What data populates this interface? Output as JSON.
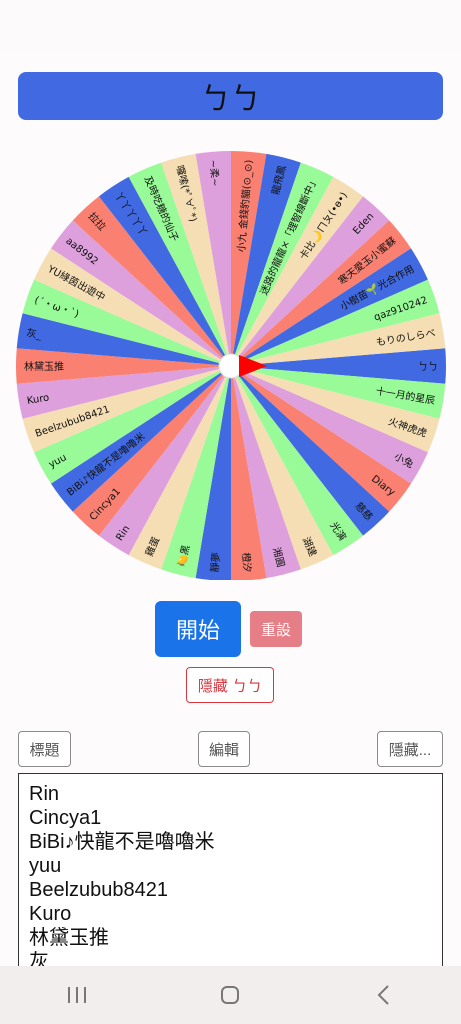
{
  "result": {
    "text": "ㄅㄅ"
  },
  "wheel": {
    "colors": [
      "#4169e1",
      "#98fb98",
      "#f5deb3",
      "#dda0dd",
      "#fa8072"
    ],
    "pointer_color": "#ff0000",
    "segments": [
      "ㄅㄅ",
      "十一月的星辰",
      "火神虎虎",
      "小兔",
      "Diary",
      "慈慈",
      "光演",
      "湖建",
      "湘圓",
      "橙汐",
      "靜夢",
      "🍋黑",
      "雞蛋",
      "Rin",
      "Cincya1",
      "BiBi♪快龍不是嚕嚕米",
      "yuu",
      "Beelzubub8421",
      "Kuro",
      "林黛玉推",
      "灰_",
      "(´・ω・`)",
      "YU綠茵出遊中",
      "aa8992",
      "拉拉",
      "丫丫丫丫丫",
      "及時吃糖的仙子",
      "囉嗦(*ﾟ∀ﾟ*)",
      "~柔~",
      "小九 金錢豹貓(⊙_⊙)",
      "龍飛鳳",
      "迷路的龍龍×「理智線斷中」",
      "卡比🌙ㄇㄆ(•ө•)",
      "Eden",
      "寒天愛玉小蜜蘇",
      "小樹苗🌱光合作用",
      "qaz910242",
      "もりのしらべ"
    ]
  },
  "controls": {
    "start_label": "開始",
    "reset_label": "重設",
    "hide_result_label": "隱藏 ㄅㄅ"
  },
  "toolbar": {
    "title_label": "標題",
    "edit_label": "編輯",
    "hide_label": "隱藏..."
  },
  "entries": [
    "Rin",
    "Cincya1",
    "BiBi♪快龍不是嚕嚕米",
    "yuu",
    "Beelzubub8421",
    "Kuro",
    "林黛玉推",
    "灰_"
  ],
  "navbar": {
    "icons": [
      "recent-apps-icon",
      "home-icon",
      "back-icon"
    ]
  }
}
